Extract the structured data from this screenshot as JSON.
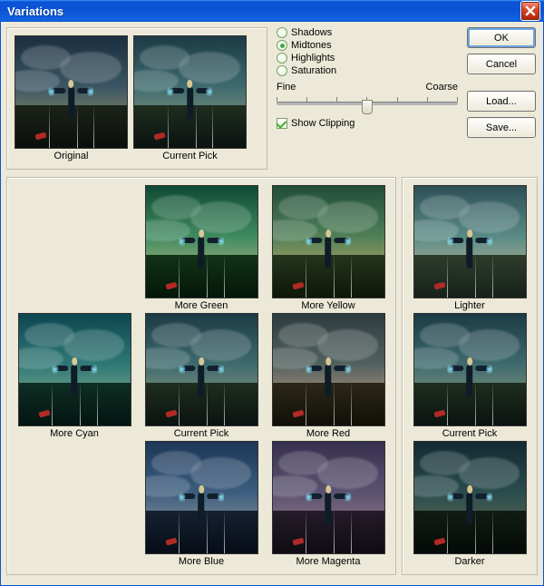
{
  "window": {
    "title": "Variations"
  },
  "top": {
    "original_label": "Original",
    "current_label": "Current Pick"
  },
  "radios": {
    "shadows": "Shadows",
    "midtones": "Midtones",
    "highlights": "Highlights",
    "saturation": "Saturation",
    "selected": "midtones"
  },
  "slider": {
    "left": "Fine",
    "right": "Coarse"
  },
  "show_clipping": {
    "label": "Show Clipping",
    "checked": true
  },
  "buttons": {
    "ok": "OK",
    "cancel": "Cancel",
    "load": "Load...",
    "save": "Save..."
  },
  "grid": {
    "more_green": "More Green",
    "more_yellow": "More Yellow",
    "more_cyan": "More Cyan",
    "current": "Current Pick",
    "more_red": "More Red",
    "more_blue": "More Blue",
    "more_magenta": "More Magenta"
  },
  "right": {
    "lighter": "Lighter",
    "current": "Current Pick",
    "darker": "Darker"
  }
}
